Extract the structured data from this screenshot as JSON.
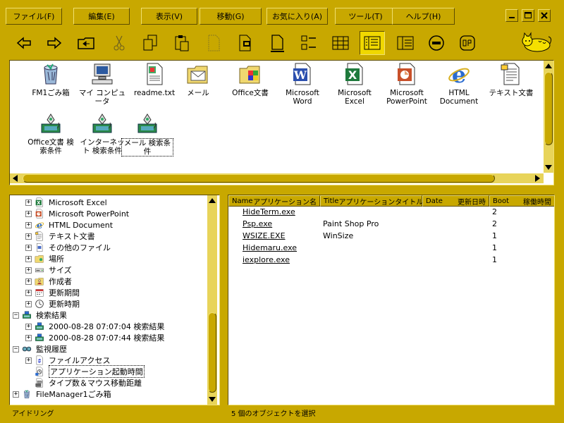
{
  "menu": [
    "ファイル(F)",
    "編集(E)",
    "表示(V)",
    "移動(G)",
    "お気に入り(A)",
    "ツール(T)",
    "ヘルプ(H)"
  ],
  "icons_top": [
    {
      "label": "FM1ごみ箱",
      "icon": "recycle-bin-icon"
    },
    {
      "label": "マイ コンピュータ",
      "icon": "my-computer-icon"
    },
    {
      "label": "readme.txt",
      "icon": "text-file-icon"
    },
    {
      "label": "メール",
      "icon": "mail-folder-icon"
    },
    {
      "label": "Office文書",
      "icon": "office-folder-icon"
    },
    {
      "label": "Microsoft Word",
      "icon": "word-icon"
    },
    {
      "label": "Microsoft Excel",
      "icon": "excel-icon"
    },
    {
      "label": "Microsoft PowerPoint",
      "icon": "powerpoint-icon"
    },
    {
      "label": "HTML Document",
      "icon": "ie-icon"
    },
    {
      "label": "テキスト文書",
      "icon": "text-document-icon"
    },
    {
      "label": "Office文書 検索条件",
      "icon": "search-condition-icon"
    },
    {
      "label": "インターネット 検索条件",
      "icon": "search-condition-icon"
    },
    {
      "label": "メール 検索条件",
      "icon": "search-condition-icon"
    }
  ],
  "tree": [
    {
      "label": "Microsoft Excel",
      "icon": "excel-icon",
      "exp": "+",
      "level": 1
    },
    {
      "label": "Microsoft PowerPoint",
      "icon": "powerpoint-icon",
      "exp": "+",
      "level": 1
    },
    {
      "label": "HTML Document",
      "icon": "ie-icon",
      "exp": "+",
      "level": 1
    },
    {
      "label": "テキスト文書",
      "icon": "text-document-icon",
      "exp": "+",
      "level": 1
    },
    {
      "label": "その他のファイル",
      "icon": "file-icon",
      "exp": "+",
      "level": 1
    },
    {
      "label": "場所",
      "icon": "folder-icon",
      "exp": "+",
      "level": 1
    },
    {
      "label": "サイズ",
      "icon": "drive-icon",
      "exp": "+",
      "level": 1
    },
    {
      "label": "作成者",
      "icon": "author-icon",
      "exp": "+",
      "level": 1
    },
    {
      "label": "更新期間",
      "icon": "calendar-icon",
      "exp": "+",
      "level": 1
    },
    {
      "label": "更新時期",
      "icon": "clock-icon",
      "exp": "+",
      "level": 1
    },
    {
      "label": "検索結果",
      "icon": "search-results-icon",
      "exp": "−",
      "level": 0
    },
    {
      "label": "2000-08-28 07:07:04 検索結果",
      "icon": "search-results-icon",
      "exp": "+",
      "level": 1
    },
    {
      "label": "2000-08-28 07:07:44 検索結果",
      "icon": "search-results-icon",
      "exp": "+",
      "level": 1
    },
    {
      "label": "監視履歴",
      "icon": "monitor-glasses-icon",
      "exp": "−",
      "level": 0
    },
    {
      "label": "ファイルアクセス",
      "icon": "file-access-icon",
      "exp": "+",
      "level": 1
    },
    {
      "label": "アプリケーション起動時間",
      "icon": "app-launch-icon",
      "exp": "",
      "level": 1
    },
    {
      "label": "タイプ数＆マウス移動距離",
      "icon": "keyboard-mouse-icon",
      "exp": "",
      "level": 1
    },
    {
      "label": "FileManager1ごみ箱",
      "icon": "recycle-bin-icon",
      "exp": "+",
      "level": 0
    }
  ],
  "columns": [
    {
      "name": "Name",
      "sub": "アプリケーション名"
    },
    {
      "name": "Title",
      "sub": "アプリケーションタイトル"
    },
    {
      "name": "Date",
      "sub": "更新日時"
    },
    {
      "name": "Boot",
      "sub": "稼働時間"
    }
  ],
  "rows": [
    {
      "name": "HideTerm.exe",
      "title": "",
      "date": "",
      "boot": "2"
    },
    {
      "name": "Psp.exe",
      "title": "Paint Shop Pro",
      "date": "",
      "boot": "2"
    },
    {
      "name": "WSIZE.EXE",
      "title": "WinSize",
      "date": "",
      "boot": "1"
    },
    {
      "name": "Hidemaru.exe",
      "title": "",
      "date": "",
      "boot": "1"
    },
    {
      "name": "iexplore.exe",
      "title": "",
      "date": "",
      "boot": "1"
    }
  ],
  "status_left": "アイドリング",
  "status_right": "5 個のオブジェクトを選択",
  "colors": {
    "chrome": "#c8a800",
    "highlight": "#f0e070",
    "shadow": "#5c4c00",
    "track": "#e8d45a"
  }
}
